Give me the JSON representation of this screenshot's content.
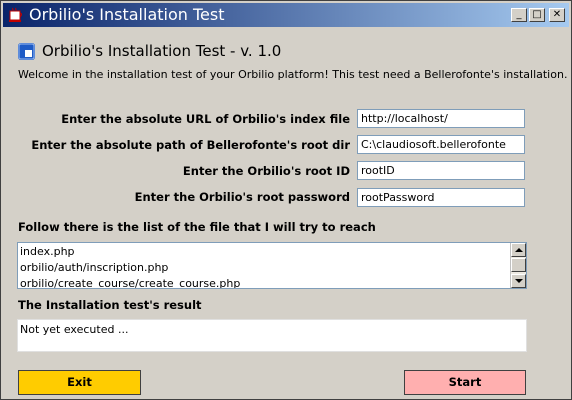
{
  "window": {
    "title": "Orbilio's Installation Test",
    "buttons": {
      "minimize": "_",
      "maximize": "□",
      "close": "✕"
    }
  },
  "header": {
    "title": "Orbilio's Installation Test - v. 1.0",
    "welcome": "Welcome in the installation test of your Orbilio platform! This test need a Bellerofonte's installation."
  },
  "form": {
    "url_label": "Enter the absolute URL of Orbilio's index file",
    "url_value": "http://localhost/",
    "path_label": "Enter the absolute path of Bellerofonte's root dir",
    "path_value": "C:\\claudiosoft.bellerofonte",
    "rootid_label": "Enter the Orbilio's root ID",
    "rootid_value": "rootID",
    "password_label": "Enter the Orbilio's root password",
    "password_value": "rootPassword"
  },
  "files": {
    "heading": "Follow there is the list of the file that I will try to reach",
    "items": [
      "index.php",
      "orbilio/auth/inscription.php",
      "orbilio/create_course/create_course.php"
    ]
  },
  "result": {
    "heading": "The Installation test's result",
    "text": "Not yet executed ..."
  },
  "actions": {
    "exit_label": "Exit",
    "start_label": "Start"
  },
  "colors": {
    "exit_button": "#ffcc00",
    "start_button": "#ffafaf",
    "titlebar": "#0a246a",
    "window_bg": "#d4d0c8"
  }
}
